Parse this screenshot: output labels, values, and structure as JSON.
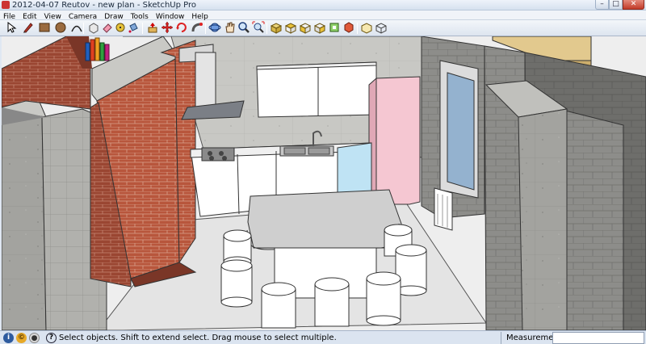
{
  "window": {
    "title": "2012-04-07 Reutov - new plan - SketchUp Pro",
    "min_glyph": "–",
    "max_glyph": "□",
    "close_glyph": "✕"
  },
  "menu": {
    "items": [
      "File",
      "Edit",
      "View",
      "Camera",
      "Draw",
      "Tools",
      "Window",
      "Help"
    ]
  },
  "toolbar": {
    "tools": [
      "select-tool",
      "pencil-tool",
      "rectangle-tool",
      "circle-tool",
      "arc-tool",
      "eraser-tool",
      "paint-bucket-tool",
      "push-pull-tool",
      "move-tool",
      "rotate-tool",
      "follow-me-tool",
      "scale-tool",
      "offset-tool",
      "tape-measure-tool",
      "dimension-tool",
      "protractor-tool",
      "text-tool",
      "axes-tool",
      "3d-text-tool",
      "orbit-tool",
      "pan-tool",
      "zoom-tool",
      "zoom-extents-tool",
      "previous-view-tool",
      "next-view-tool",
      "position-camera-tool",
      "walk-tool",
      "look-around-tool",
      "section-plane-tool",
      "get-models-tool",
      "share-model-tool",
      "component-tool",
      "extension-tool"
    ]
  },
  "status": {
    "text": "Select objects. Shift to extend select. Drag mouse to select multiple.",
    "measurements_label": "Measurements",
    "measurements_value": "",
    "help_glyph": "?"
  },
  "colors": {
    "brick": "#b5533c",
    "concrete": "#9d9d99",
    "fridge": "#f2c7d0",
    "dishwasher": "#bfe3f4",
    "roof": "#e2c98e",
    "ui_chrome": "#dde5ef"
  }
}
